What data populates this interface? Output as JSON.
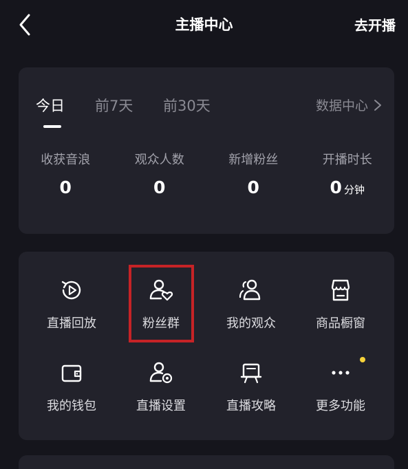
{
  "header": {
    "title": "主播中心",
    "action_label": "去开播"
  },
  "stats": {
    "tabs": [
      {
        "label": "今日",
        "active": true
      },
      {
        "label": "前7天",
        "active": false
      },
      {
        "label": "前30天",
        "active": false
      }
    ],
    "data_center_label": "数据中心",
    "items": [
      {
        "label": "收获音浪",
        "value": "0",
        "unit": ""
      },
      {
        "label": "观众人数",
        "value": "0",
        "unit": ""
      },
      {
        "label": "新增粉丝",
        "value": "0",
        "unit": ""
      },
      {
        "label": "开播时长",
        "value": "0",
        "unit": "分钟"
      }
    ]
  },
  "tools": {
    "items": [
      {
        "label": "直播回放",
        "icon": "replay-icon"
      },
      {
        "label": "粉丝群",
        "icon": "fan-group-icon"
      },
      {
        "label": "我的观众",
        "icon": "audience-icon"
      },
      {
        "label": "商品橱窗",
        "icon": "shop-window-icon"
      },
      {
        "label": "我的钱包",
        "icon": "wallet-icon"
      },
      {
        "label": "直播设置",
        "icon": "live-settings-icon"
      },
      {
        "label": "直播攻略",
        "icon": "live-guide-icon"
      },
      {
        "label": "更多功能",
        "icon": "more-icon"
      }
    ]
  },
  "colors": {
    "background": "#15151c",
    "card": "#22222b",
    "highlight": "#c62326",
    "badge": "#f6d23a"
  }
}
